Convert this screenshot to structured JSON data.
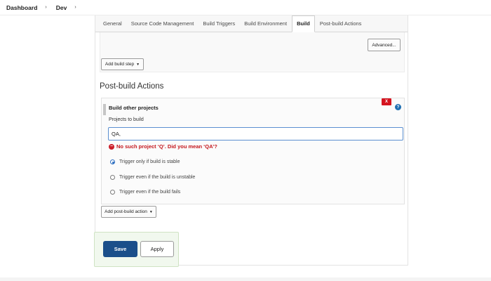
{
  "breadcrumb": {
    "items": [
      "Dashboard",
      "Dev"
    ],
    "separator": "›"
  },
  "tabs": [
    {
      "label": "General",
      "active": false
    },
    {
      "label": "Source Code Management",
      "active": false
    },
    {
      "label": "Build Triggers",
      "active": false
    },
    {
      "label": "Build Environment",
      "active": false
    },
    {
      "label": "Build",
      "active": true
    },
    {
      "label": "Post-build Actions",
      "active": false
    }
  ],
  "build": {
    "advanced_label": "Advanced...",
    "add_step_label": "Add build step",
    "caret": "▼"
  },
  "post_build": {
    "section_title": "Post-build Actions",
    "step_title": "Build other projects",
    "delete_label": "X",
    "help_label": "?",
    "projects_label": "Projects to build",
    "projects_value": "QA,",
    "error_icon": "−",
    "error_text": "No such project ‘Q’. Did you mean ‘QA’?",
    "options": [
      {
        "label": "Trigger only if build is stable",
        "checked": true
      },
      {
        "label": "Trigger even if the build is unstable",
        "checked": false
      },
      {
        "label": "Trigger even if the build fails",
        "checked": false
      }
    ],
    "add_action_label": "Add post-build action"
  },
  "actions": {
    "save_label": "Save",
    "apply_label": "Apply"
  },
  "colors": {
    "save_button": "#1b4f8a",
    "error": "#c4161c",
    "delete": "#d5141f",
    "help": "#1f6fb2"
  }
}
